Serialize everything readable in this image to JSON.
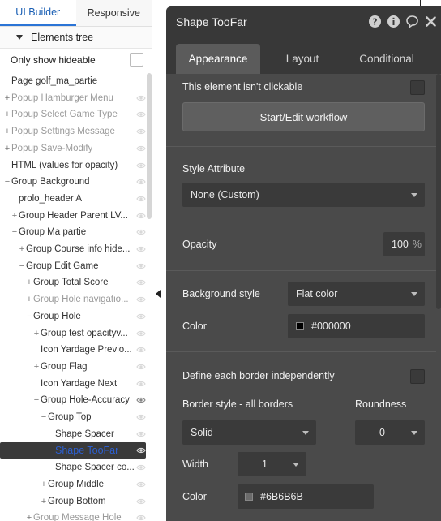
{
  "left_panel": {
    "tabs": [
      "UI Builder",
      "Responsive"
    ],
    "tree_header": "Elements tree",
    "only_hideable_label": "Only show hideable",
    "tree": [
      {
        "label": "Page golf_ma_partie",
        "indent": 0,
        "toggle": "",
        "dim": false,
        "selected": false,
        "eye": false
      },
      {
        "label": "Popup Hamburger Menu",
        "indent": 0,
        "toggle": "+",
        "dim": true,
        "selected": false,
        "eye": true
      },
      {
        "label": "Popup Select Game Type",
        "indent": 0,
        "toggle": "+",
        "dim": true,
        "selected": false,
        "eye": true
      },
      {
        "label": "Popup Settings Message",
        "indent": 0,
        "toggle": "+",
        "dim": true,
        "selected": false,
        "eye": true
      },
      {
        "label": "Popup Save-Modify",
        "indent": 0,
        "toggle": "+",
        "dim": true,
        "selected": false,
        "eye": true
      },
      {
        "label": "HTML (values for opacity)",
        "indent": 0,
        "toggle": "",
        "dim": false,
        "selected": false,
        "eye": true
      },
      {
        "label": "Group Background",
        "indent": 0,
        "toggle": "−",
        "dim": false,
        "selected": false,
        "eye": true
      },
      {
        "label": "prolo_header A",
        "indent": 1,
        "toggle": "",
        "dim": false,
        "selected": false,
        "eye": true
      },
      {
        "label": "Group Header Parent LV...",
        "indent": 1,
        "toggle": "+",
        "dim": false,
        "selected": false,
        "eye": true
      },
      {
        "label": "Group Ma partie",
        "indent": 1,
        "toggle": "−",
        "dim": false,
        "selected": false,
        "eye": true
      },
      {
        "label": "Group Course info hide...",
        "indent": 2,
        "toggle": "+",
        "dim": false,
        "selected": false,
        "eye": true
      },
      {
        "label": "Group Edit Game",
        "indent": 2,
        "toggle": "−",
        "dim": false,
        "selected": false,
        "eye": true
      },
      {
        "label": "Group Total Score",
        "indent": 3,
        "toggle": "+",
        "dim": false,
        "selected": false,
        "eye": true
      },
      {
        "label": "Group Hole navigatio...",
        "indent": 3,
        "toggle": "+",
        "dim": true,
        "selected": false,
        "eye": true
      },
      {
        "label": "Group Hole",
        "indent": 3,
        "toggle": "−",
        "dim": false,
        "selected": false,
        "eye": true
      },
      {
        "label": "Group test opacityv...",
        "indent": 4,
        "toggle": "+",
        "dim": false,
        "selected": false,
        "eye": true
      },
      {
        "label": "Icon Yardage Previo...",
        "indent": 4,
        "toggle": "",
        "dim": false,
        "selected": false,
        "eye": true
      },
      {
        "label": "Group Flag",
        "indent": 4,
        "toggle": "+",
        "dim": false,
        "selected": false,
        "eye": true
      },
      {
        "label": "Icon Yardage Next",
        "indent": 4,
        "toggle": "",
        "dim": false,
        "selected": false,
        "eye": true
      },
      {
        "label": "Group Hole-Accuracy",
        "indent": 4,
        "toggle": "−",
        "dim": false,
        "selected": false,
        "eye": true
      },
      {
        "label": "Group Top",
        "indent": 5,
        "toggle": "−",
        "dim": false,
        "selected": false,
        "eye": true
      },
      {
        "label": "Shape Spacer",
        "indent": 6,
        "toggle": "",
        "dim": false,
        "selected": false,
        "eye": true
      },
      {
        "label": "Shape TooFar",
        "indent": 6,
        "toggle": "",
        "dim": false,
        "selected": true,
        "eye": true
      },
      {
        "label": "Shape Spacer co...",
        "indent": 6,
        "toggle": "",
        "dim": false,
        "selected": false,
        "eye": true
      },
      {
        "label": "Group Middle",
        "indent": 5,
        "toggle": "+",
        "dim": false,
        "selected": false,
        "eye": true
      },
      {
        "label": "Group Bottom",
        "indent": 5,
        "toggle": "+",
        "dim": false,
        "selected": false,
        "eye": true
      },
      {
        "label": "Group Message Hole",
        "indent": 3,
        "toggle": "+",
        "dim": true,
        "selected": false,
        "eye": true
      }
    ]
  },
  "editor": {
    "title": "Shape TooFar",
    "icons": [
      "help-icon",
      "info-icon",
      "comment-icon",
      "close-icon"
    ],
    "tabs": [
      "Appearance",
      "Layout",
      "Conditional"
    ],
    "not_clickable_label": "This element isn't clickable",
    "workflow_button": "Start/Edit workflow",
    "style_attribute_label": "Style Attribute",
    "style_attribute_value": "None (Custom)",
    "opacity_label": "Opacity",
    "opacity_value": "100",
    "opacity_unit": "%",
    "background_style_label": "Background style",
    "background_style_value": "Flat color",
    "color_label": "Color",
    "color_value": "#000000",
    "border_independent_label": "Define each border independently",
    "border_style_label": "Border style - all borders",
    "border_style_value": "Solid",
    "roundness_label": "Roundness",
    "roundness_value": "0",
    "width_label": "Width",
    "width_value": "1",
    "border_color_label": "Color",
    "border_color_value": "#6B6B6B"
  },
  "colors": {
    "swatch_background": "#000000",
    "swatch_border": "#6B6B6B",
    "accent": "#2c5fd0"
  }
}
